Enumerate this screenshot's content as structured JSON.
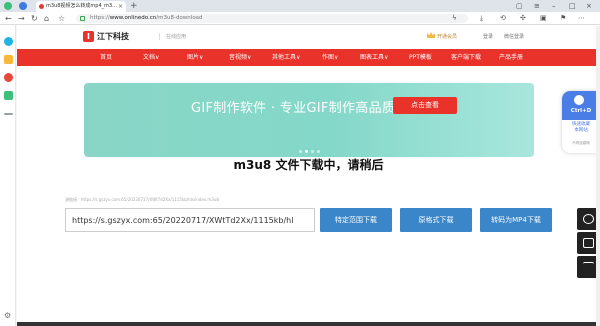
{
  "browser": {
    "tab_title": "m3u8视频怎么转成mp4_m3...",
    "address_host": "www.onlinedo.cn",
    "address_path": "/m3u8-download",
    "address_prefix": "https://"
  },
  "header": {
    "logo_text": "江下科技",
    "slogan": "在线应用",
    "vip": "开通会员",
    "login": "登录",
    "register": "微信登录"
  },
  "menu": {
    "items": [
      "首页",
      "文档∨",
      "图片∨",
      "音视频∨",
      "其他工具∨",
      "作图∨",
      "图表工具∨",
      "PPT模板",
      "客户端下载",
      "产品手册"
    ]
  },
  "banner": {
    "title": "GIF制作软件 · 专业GIF制作高品质",
    "button": "点击查看"
  },
  "main": {
    "heading": "m3u8 文件下载中，请稍后",
    "source_label": "源链接：https://s.gszyx.com:65/20220717/XWtTd2Xx/1115kb/hls/index.m3u8",
    "url_value": "https://s.gszyx.com:65/20220717/XWtTd2Xx/1115kb/hl",
    "buttons": {
      "range": "特定范围下载",
      "original": "原格式下载",
      "mp4": "转码为MP4下载"
    }
  },
  "widget": {
    "key": "Ctrl+D",
    "line1": "快速收藏",
    "line2": "本网站",
    "sub": "不再迷路哦"
  }
}
